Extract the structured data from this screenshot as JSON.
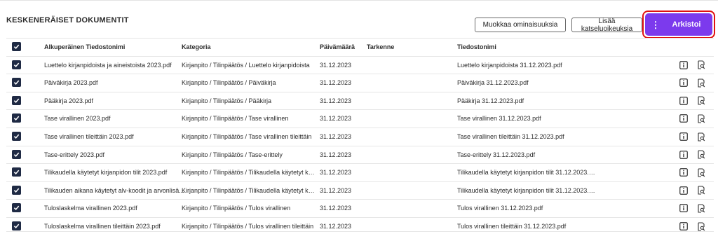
{
  "section": {
    "title": "KESKENERÄISET DOKUMENTIT"
  },
  "toolbar": {
    "edit_properties_label": "Muokkaa ominaisuuksia",
    "add_view_rights_label": "Lisää katseluoikeuksia",
    "archive_label": "Arkistoi",
    "archive_menu_glyph": "⋮"
  },
  "colors": {
    "accent": "#7c3aed",
    "highlight_border": "#e01010",
    "checkbox": "#1f2a44"
  },
  "table": {
    "columns": [
      "Alkuperäinen Tiedostonimi",
      "Kategoria",
      "Päivämäärä",
      "Tarkenne",
      "Tiedostonimi"
    ],
    "rows": [
      {
        "original": "Luettelo kirjanpidoista ja aineistoista 2023.pdf",
        "category": "Kirjanpito / Tilinpäätös / Luettelo kirjanpidoista",
        "date": "31.12.2023",
        "spec": "",
        "filename": "Luettelo kirjanpidoista 31.12.2023.pdf"
      },
      {
        "original": "Päiväkirja 2023.pdf",
        "category": "Kirjanpito / Tilinpäätös / Päiväkirja",
        "date": "31.12.2023",
        "spec": "",
        "filename": "Päiväkirja 31.12.2023.pdf"
      },
      {
        "original": "Pääkirja 2023.pdf",
        "category": "Kirjanpito / Tilinpäätös / Pääkirja",
        "date": "31.12.2023",
        "spec": "",
        "filename": "Pääkirja 31.12.2023.pdf"
      },
      {
        "original": "Tase virallinen 2023.pdf",
        "category": "Kirjanpito / Tilinpäätös / Tase virallinen",
        "date": "31.12.2023",
        "spec": "",
        "filename": "Tase virallinen 31.12.2023.pdf"
      },
      {
        "original": "Tase virallinen tileittäin 2023.pdf",
        "category": "Kirjanpito / Tilinpäätös / Tase virallinen tileittäin",
        "date": "31.12.2023",
        "spec": "",
        "filename": "Tase virallinen tileittäin 31.12.2023.pdf"
      },
      {
        "original": "Tase-erittely 2023.pdf",
        "category": "Kirjanpito / Tilinpäätös / Tase-erittely",
        "date": "31.12.2023",
        "spec": "",
        "filename": "Tase-erittely 31.12.2023.pdf"
      },
      {
        "original": "Tilikaudella käytetyt kirjanpidon tilit 2023.pdf",
        "category": "Kirjanpito / Tilinpäätös / Tilikaudella käytetyt kirj...",
        "date": "31.12.2023",
        "spec": "",
        "filename": "Tilikaudella käytetyt kirjanpidon tilit 31.12.2023.p..."
      },
      {
        "original": "Tilikauden aikana käytetyt alv-koodit ja arvonlisä...",
        "category": "Kirjanpito / Tilinpäätös / Tilikaudella käytetyt kirj...",
        "date": "31.12.2023",
        "spec": "",
        "filename": "Tilikaudella käytetyt kirjanpidon tilit 31.12.2023.p..."
      },
      {
        "original": "Tuloslaskelma virallinen 2023.pdf",
        "category": "Kirjanpito / Tilinpäätös / Tulos virallinen",
        "date": "31.12.2023",
        "spec": "",
        "filename": "Tulos virallinen 31.12.2023.pdf"
      },
      {
        "original": "Tuloslaskelma virallinen tileittäin 2023.pdf",
        "category": "Kirjanpito / Tilinpäätös / Tulos virallinen tileittäin",
        "date": "31.12.2023",
        "spec": "",
        "filename": "Tulos virallinen tileittäin 31.12.2023.pdf"
      }
    ],
    "row_icons": [
      "info-icon",
      "search-document-icon"
    ]
  }
}
